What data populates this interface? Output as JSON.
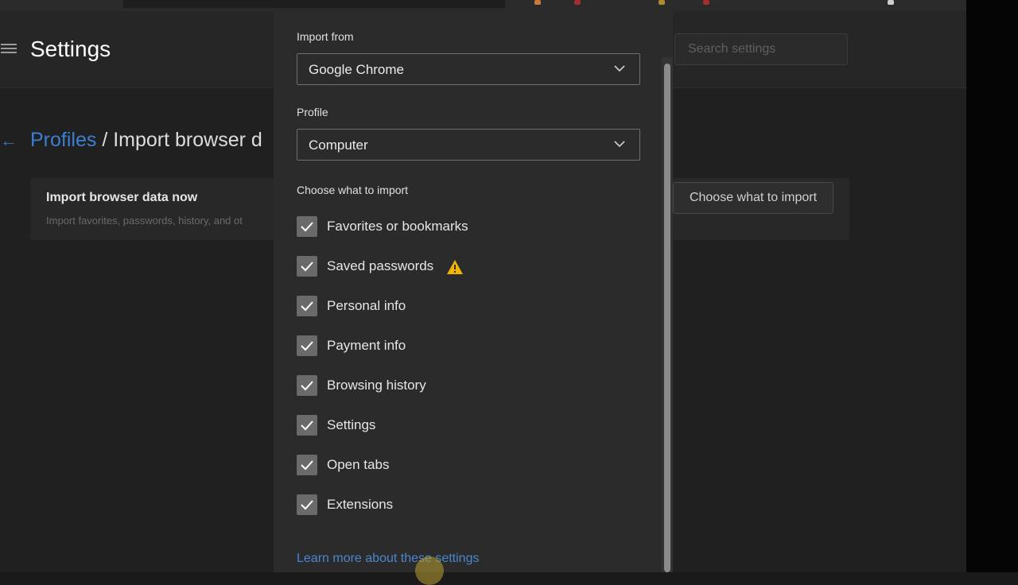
{
  "header": {
    "title": "Settings",
    "search_placeholder": "Search settings"
  },
  "breadcrumb": {
    "parent": "Profiles",
    "separator": " / ",
    "current": "Import browser d"
  },
  "card": {
    "title": "Import browser data now",
    "subtitle": "Import favorites, passwords, history, and ot",
    "button": "Choose what to import"
  },
  "dialog": {
    "import_from_label": "Import from",
    "import_from_value": "Google Chrome",
    "profile_label": "Profile",
    "profile_value": "Computer",
    "choose_label": "Choose what to import",
    "items": [
      {
        "label": "Favorites or bookmarks",
        "checked": true
      },
      {
        "label": "Saved passwords",
        "checked": true,
        "warning": true
      },
      {
        "label": "Personal info",
        "checked": true
      },
      {
        "label": "Payment info",
        "checked": true
      },
      {
        "label": "Browsing history",
        "checked": true
      },
      {
        "label": "Settings",
        "checked": true
      },
      {
        "label": "Open tabs",
        "checked": true
      },
      {
        "label": "Extensions",
        "checked": true
      }
    ],
    "learn_more": "Learn more about these settings"
  },
  "colors": {
    "link": "#3a7fd0",
    "warning": "#f0b400",
    "checkbox": "#6a6a6a"
  },
  "icons": [
    "menu-icon",
    "back-arrow-icon",
    "chevron-down-icon",
    "checkmark-icon",
    "warning-icon"
  ]
}
